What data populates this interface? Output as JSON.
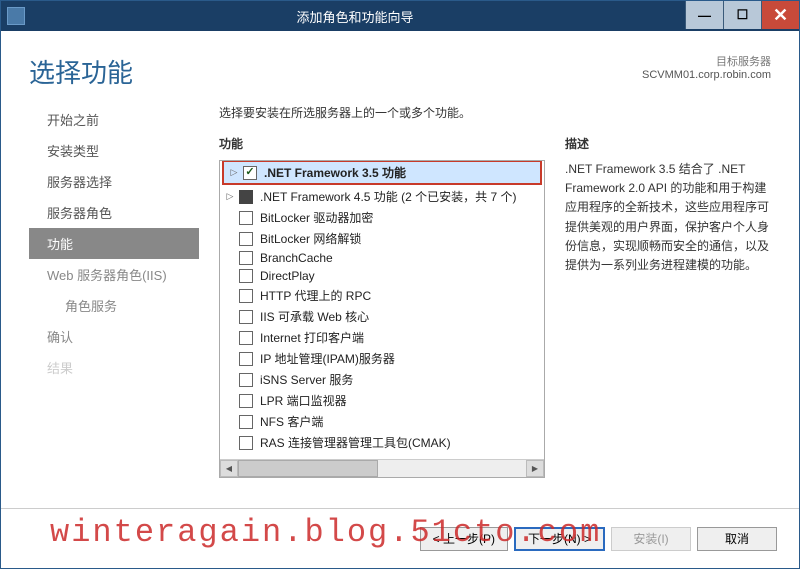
{
  "titlebar": {
    "text": "添加角色和功能向导"
  },
  "header": {
    "title": "选择功能",
    "server_label": "目标服务器",
    "server_name": "SCVMM01.corp.robin.com"
  },
  "sidebar": {
    "items": [
      {
        "label": "开始之前",
        "state": "completed"
      },
      {
        "label": "安装类型",
        "state": "completed"
      },
      {
        "label": "服务器选择",
        "state": "completed"
      },
      {
        "label": "服务器角色",
        "state": "completed"
      },
      {
        "label": "功能",
        "state": "active"
      },
      {
        "label": "Web 服务器角色(IIS)",
        "state": "pending"
      },
      {
        "label": "角色服务",
        "state": "pending",
        "sub": true
      },
      {
        "label": "确认",
        "state": "pending"
      },
      {
        "label": "结果",
        "state": "disabled"
      }
    ]
  },
  "main": {
    "instruction": "选择要安装在所选服务器上的一个或多个功能。",
    "features_header": "功能",
    "desc_header": "描述",
    "features": [
      {
        "expander": true,
        "checked": "checked",
        "label": ".NET Framework 3.5 功能",
        "bold": true,
        "selected": true,
        "boxed": true
      },
      {
        "expander": true,
        "checked": "partial",
        "label": ".NET Framework 4.5 功能 (2 个已安装，共 7 个)"
      },
      {
        "expander": false,
        "checked": "none",
        "label": "BitLocker 驱动器加密"
      },
      {
        "expander": false,
        "checked": "none",
        "label": "BitLocker 网络解锁"
      },
      {
        "expander": false,
        "checked": "none",
        "label": "BranchCache"
      },
      {
        "expander": false,
        "checked": "none",
        "label": "DirectPlay"
      },
      {
        "expander": false,
        "checked": "none",
        "label": "HTTP 代理上的 RPC"
      },
      {
        "expander": false,
        "checked": "none",
        "label": "IIS 可承载 Web 核心"
      },
      {
        "expander": false,
        "checked": "none",
        "label": "Internet 打印客户端"
      },
      {
        "expander": false,
        "checked": "none",
        "label": "IP 地址管理(IPAM)服务器"
      },
      {
        "expander": false,
        "checked": "none",
        "label": "iSNS Server 服务"
      },
      {
        "expander": false,
        "checked": "none",
        "label": "LPR 端口监视器"
      },
      {
        "expander": false,
        "checked": "none",
        "label": "NFS 客户端"
      },
      {
        "expander": false,
        "checked": "none",
        "label": "RAS 连接管理器管理工具包(CMAK)"
      }
    ],
    "description": ".NET Framework 3.5 结合了 .NET Framework 2.0 API 的功能和用于构建应用程序的全新技术，这些应用程序可提供美观的用户界面，保护客户个人身份信息，实现顺畅而安全的通信，以及提供为一系列业务进程建模的功能。"
  },
  "footer": {
    "prev": "< 上一步(P)",
    "next": "下一步(N) >",
    "install": "安装(I)",
    "cancel": "取消"
  },
  "watermark": "winteragain.blog.51cto.com"
}
